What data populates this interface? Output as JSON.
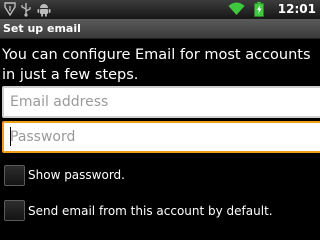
{
  "status_bar": {
    "time": "12:01",
    "icons": [
      "usb-debug-icon",
      "usb-connected-icon",
      "android-icon",
      "wifi-icon",
      "battery-icon"
    ]
  },
  "title_bar": {
    "title": "Set up email"
  },
  "instructions": "You can configure Email for most accounts in just a few steps.",
  "form": {
    "email": {
      "value": "",
      "placeholder": "Email address"
    },
    "password": {
      "value": "",
      "placeholder": "Password",
      "focused": true
    },
    "show_password": {
      "label": "Show password.",
      "checked": false
    },
    "default_account": {
      "label": "Send email from this account by default.",
      "checked": false
    }
  },
  "colors": {
    "focus_border": "#f39c1a",
    "title_bar": "#4a4a4a",
    "background": "#000000"
  }
}
